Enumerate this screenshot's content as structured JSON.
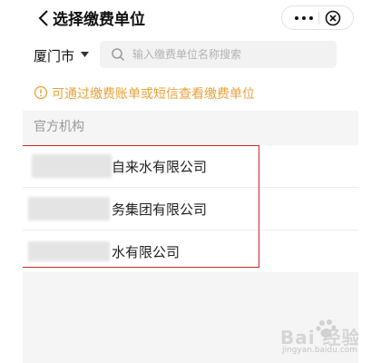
{
  "header": {
    "title": "选择缴费单位",
    "more_label": "•••",
    "back_icon": "chevron-left-icon",
    "close_icon": "close-circle-icon"
  },
  "search": {
    "city": "厦门市",
    "placeholder": "输入缴费单位名称搜索",
    "icon": "search-icon"
  },
  "tip": {
    "text": "可通过缴费账单或短信查看缴费单位",
    "color": "#e8a23a",
    "icon": "info-circle-icon"
  },
  "section": {
    "title": "官方机构"
  },
  "companies": [
    {
      "name": "自来水有限公司"
    },
    {
      "name": "务集团有限公司"
    },
    {
      "name": "水有限公司"
    }
  ],
  "watermark": {
    "text": "Bai 经验",
    "sub": "jingyan.baidu.com"
  },
  "colors": {
    "highlight_border": "#c62828",
    "background": "#f5f5f5"
  }
}
